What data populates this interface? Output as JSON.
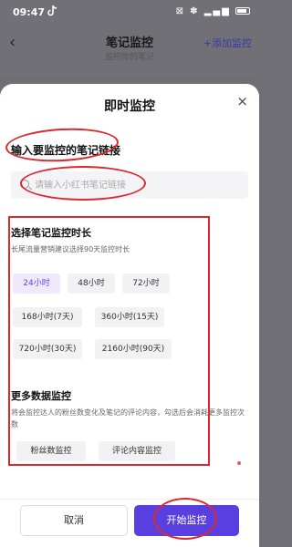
{
  "status_bar": {
    "time": "09:47",
    "right_icons": "⊠ ✽ ▂▄▆"
  },
  "header": {
    "back": "‹",
    "title": "笔记监控",
    "subtitle": "监控你的笔记",
    "add_label": "+添加监控"
  },
  "sheet": {
    "title": "即时监控",
    "close": "×",
    "link_label": "输入要监控的笔记链接",
    "search_placeholder": "请输入小红书笔记链接",
    "duration": {
      "title": "选择笔记监控时长",
      "subtitle": "长尾流量营销建议选择90天监控时长",
      "options": [
        {
          "label": "24小时",
          "selected": true
        },
        {
          "label": "48小时",
          "selected": false
        },
        {
          "label": "72小时",
          "selected": false
        },
        {
          "label": "168小时(7天)",
          "selected": false
        },
        {
          "label": "360小时(15天)",
          "selected": false
        },
        {
          "label": "720小时(30天)",
          "selected": false
        },
        {
          "label": "2160小时(90天)",
          "selected": false
        }
      ]
    },
    "more_data": {
      "title": "更多数据监控",
      "subtitle": "将会监控达人的粉丝数变化及笔记的评论内容，勾选后会消耗更多监控次数",
      "options": [
        "粉丝数监控",
        "评论内容监控"
      ]
    },
    "footer": {
      "cancel_label": "取消",
      "start_label": "开始监控"
    }
  },
  "colors": {
    "accent": "#5a3fe0",
    "annotation": "#d92a30"
  }
}
